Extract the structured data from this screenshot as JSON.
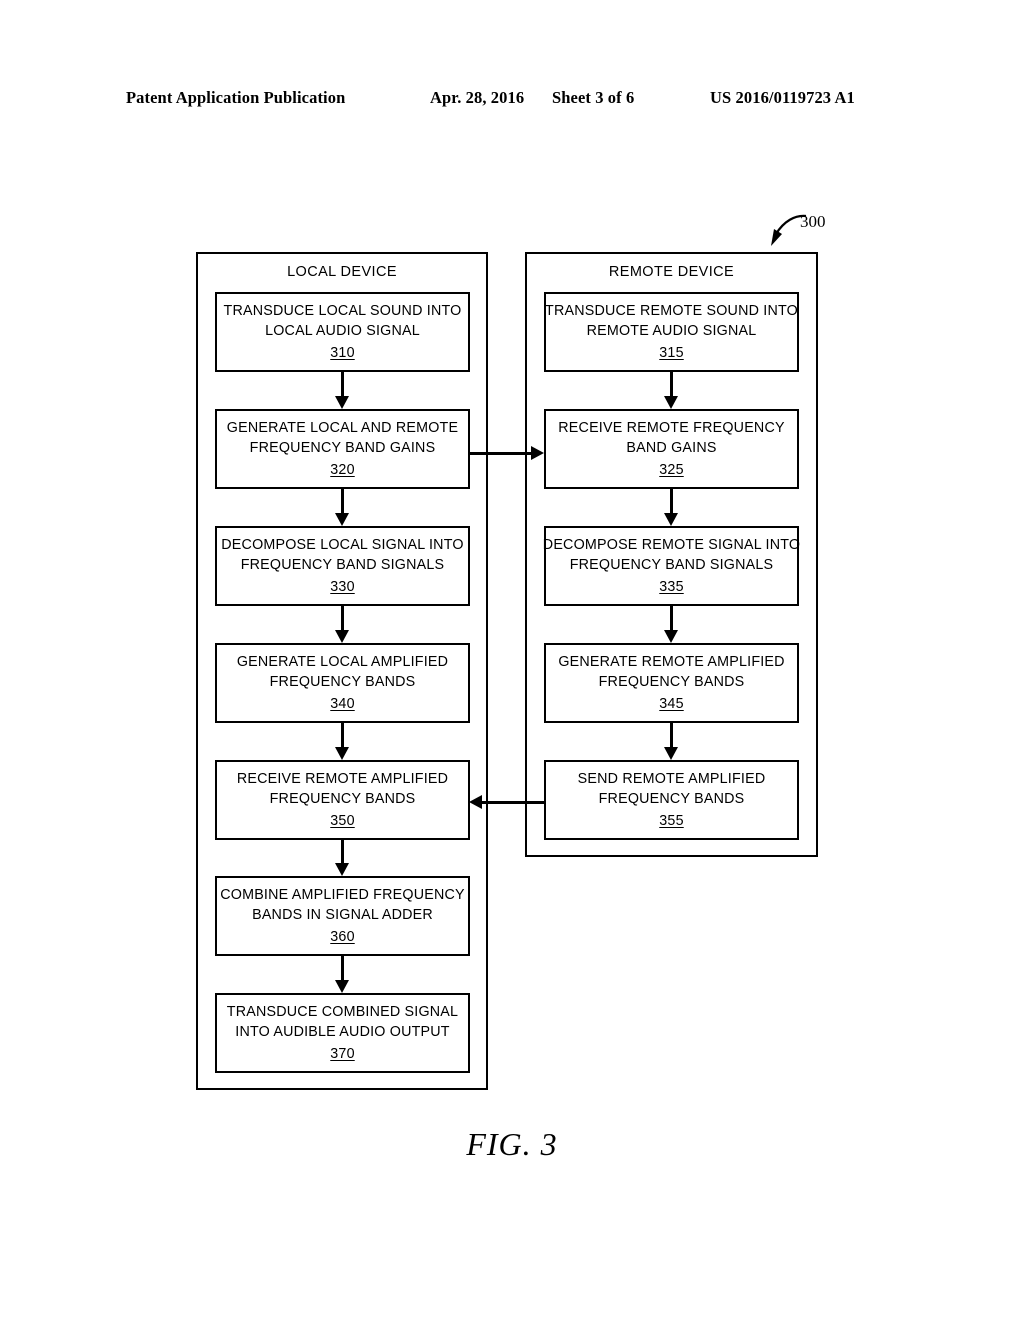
{
  "header": {
    "publication": "Patent Application Publication",
    "date": "Apr. 28, 2016",
    "sheet": "Sheet 3 of 6",
    "patent_number": "US 2016/0119723 A1"
  },
  "figure": {
    "caption": "FIG. 3",
    "reference_numeral": "300"
  },
  "containers": {
    "local": {
      "title": "LOCAL DEVICE"
    },
    "remote": {
      "title": "REMOTE DEVICE"
    }
  },
  "steps": {
    "local": [
      {
        "line1": "TRANSDUCE LOCAL SOUND INTO",
        "line2": "LOCAL AUDIO SIGNAL",
        "ref": "310"
      },
      {
        "line1": "GENERATE LOCAL AND REMOTE",
        "line2": "FREQUENCY BAND GAINS",
        "ref": "320"
      },
      {
        "line1": "DECOMPOSE LOCAL SIGNAL INTO",
        "line2": "FREQUENCY BAND SIGNALS",
        "ref": "330"
      },
      {
        "line1": "GENERATE LOCAL AMPLIFIED",
        "line2": "FREQUENCY BANDS",
        "ref": "340"
      },
      {
        "line1": "RECEIVE REMOTE AMPLIFIED",
        "line2": "FREQUENCY BANDS",
        "ref": "350"
      },
      {
        "line1": "COMBINE AMPLIFIED FREQUENCY",
        "line2": "BANDS IN SIGNAL ADDER",
        "ref": "360"
      },
      {
        "line1": "TRANSDUCE COMBINED SIGNAL",
        "line2": "INTO AUDIBLE AUDIO OUTPUT",
        "ref": "370"
      }
    ],
    "remote": [
      {
        "line1": "TRANSDUCE REMOTE SOUND INTO",
        "line2": "REMOTE AUDIO SIGNAL",
        "ref": "315"
      },
      {
        "line1": "RECEIVE REMOTE FREQUENCY",
        "line2": "BAND GAINS",
        "ref": "325"
      },
      {
        "line1": "DECOMPOSE REMOTE SIGNAL INTO",
        "line2": "FREQUENCY BAND SIGNALS",
        "ref": "335"
      },
      {
        "line1": "GENERATE REMOTE AMPLIFIED",
        "line2": "FREQUENCY BANDS",
        "ref": "345"
      },
      {
        "line1": "SEND REMOTE AMPLIFIED",
        "line2": "FREQUENCY BANDS",
        "ref": "355"
      }
    ]
  },
  "chart_data": {
    "type": "diagram",
    "title": "FIG. 3",
    "diagram_kind": "flowchart",
    "swimlanes": [
      "LOCAL DEVICE",
      "REMOTE DEVICE"
    ],
    "nodes": [
      {
        "id": "310",
        "lane": "LOCAL DEVICE",
        "label": "TRANSDUCE LOCAL SOUND INTO LOCAL AUDIO SIGNAL"
      },
      {
        "id": "320",
        "lane": "LOCAL DEVICE",
        "label": "GENERATE LOCAL AND REMOTE FREQUENCY BAND GAINS"
      },
      {
        "id": "330",
        "lane": "LOCAL DEVICE",
        "label": "DECOMPOSE LOCAL SIGNAL INTO FREQUENCY BAND SIGNALS"
      },
      {
        "id": "340",
        "lane": "LOCAL DEVICE",
        "label": "GENERATE LOCAL AMPLIFIED FREQUENCY BANDS"
      },
      {
        "id": "350",
        "lane": "LOCAL DEVICE",
        "label": "RECEIVE REMOTE AMPLIFIED FREQUENCY BANDS"
      },
      {
        "id": "360",
        "lane": "LOCAL DEVICE",
        "label": "COMBINE AMPLIFIED FREQUENCY BANDS IN SIGNAL ADDER"
      },
      {
        "id": "370",
        "lane": "LOCAL DEVICE",
        "label": "TRANSDUCE COMBINED SIGNAL INTO AUDIBLE AUDIO OUTPUT"
      },
      {
        "id": "315",
        "lane": "REMOTE DEVICE",
        "label": "TRANSDUCE REMOTE SOUND INTO REMOTE AUDIO SIGNAL"
      },
      {
        "id": "325",
        "lane": "REMOTE DEVICE",
        "label": "RECEIVE REMOTE FREQUENCY BAND GAINS"
      },
      {
        "id": "335",
        "lane": "REMOTE DEVICE",
        "label": "DECOMPOSE REMOTE SIGNAL INTO FREQUENCY BAND SIGNALS"
      },
      {
        "id": "345",
        "lane": "REMOTE DEVICE",
        "label": "GENERATE REMOTE AMPLIFIED FREQUENCY BANDS"
      },
      {
        "id": "355",
        "lane": "REMOTE DEVICE",
        "label": "SEND REMOTE AMPLIFIED FREQUENCY BANDS"
      }
    ],
    "edges": [
      {
        "from": "310",
        "to": "320",
        "direction": "down"
      },
      {
        "from": "320",
        "to": "330",
        "direction": "down"
      },
      {
        "from": "330",
        "to": "340",
        "direction": "down"
      },
      {
        "from": "340",
        "to": "350",
        "direction": "down"
      },
      {
        "from": "350",
        "to": "360",
        "direction": "down"
      },
      {
        "from": "360",
        "to": "370",
        "direction": "down"
      },
      {
        "from": "315",
        "to": "325",
        "direction": "down"
      },
      {
        "from": "325",
        "to": "335",
        "direction": "down"
      },
      {
        "from": "335",
        "to": "345",
        "direction": "down"
      },
      {
        "from": "345",
        "to": "355",
        "direction": "down"
      },
      {
        "from": "320",
        "to": "325",
        "direction": "right"
      },
      {
        "from": "355",
        "to": "350",
        "direction": "left"
      }
    ]
  }
}
